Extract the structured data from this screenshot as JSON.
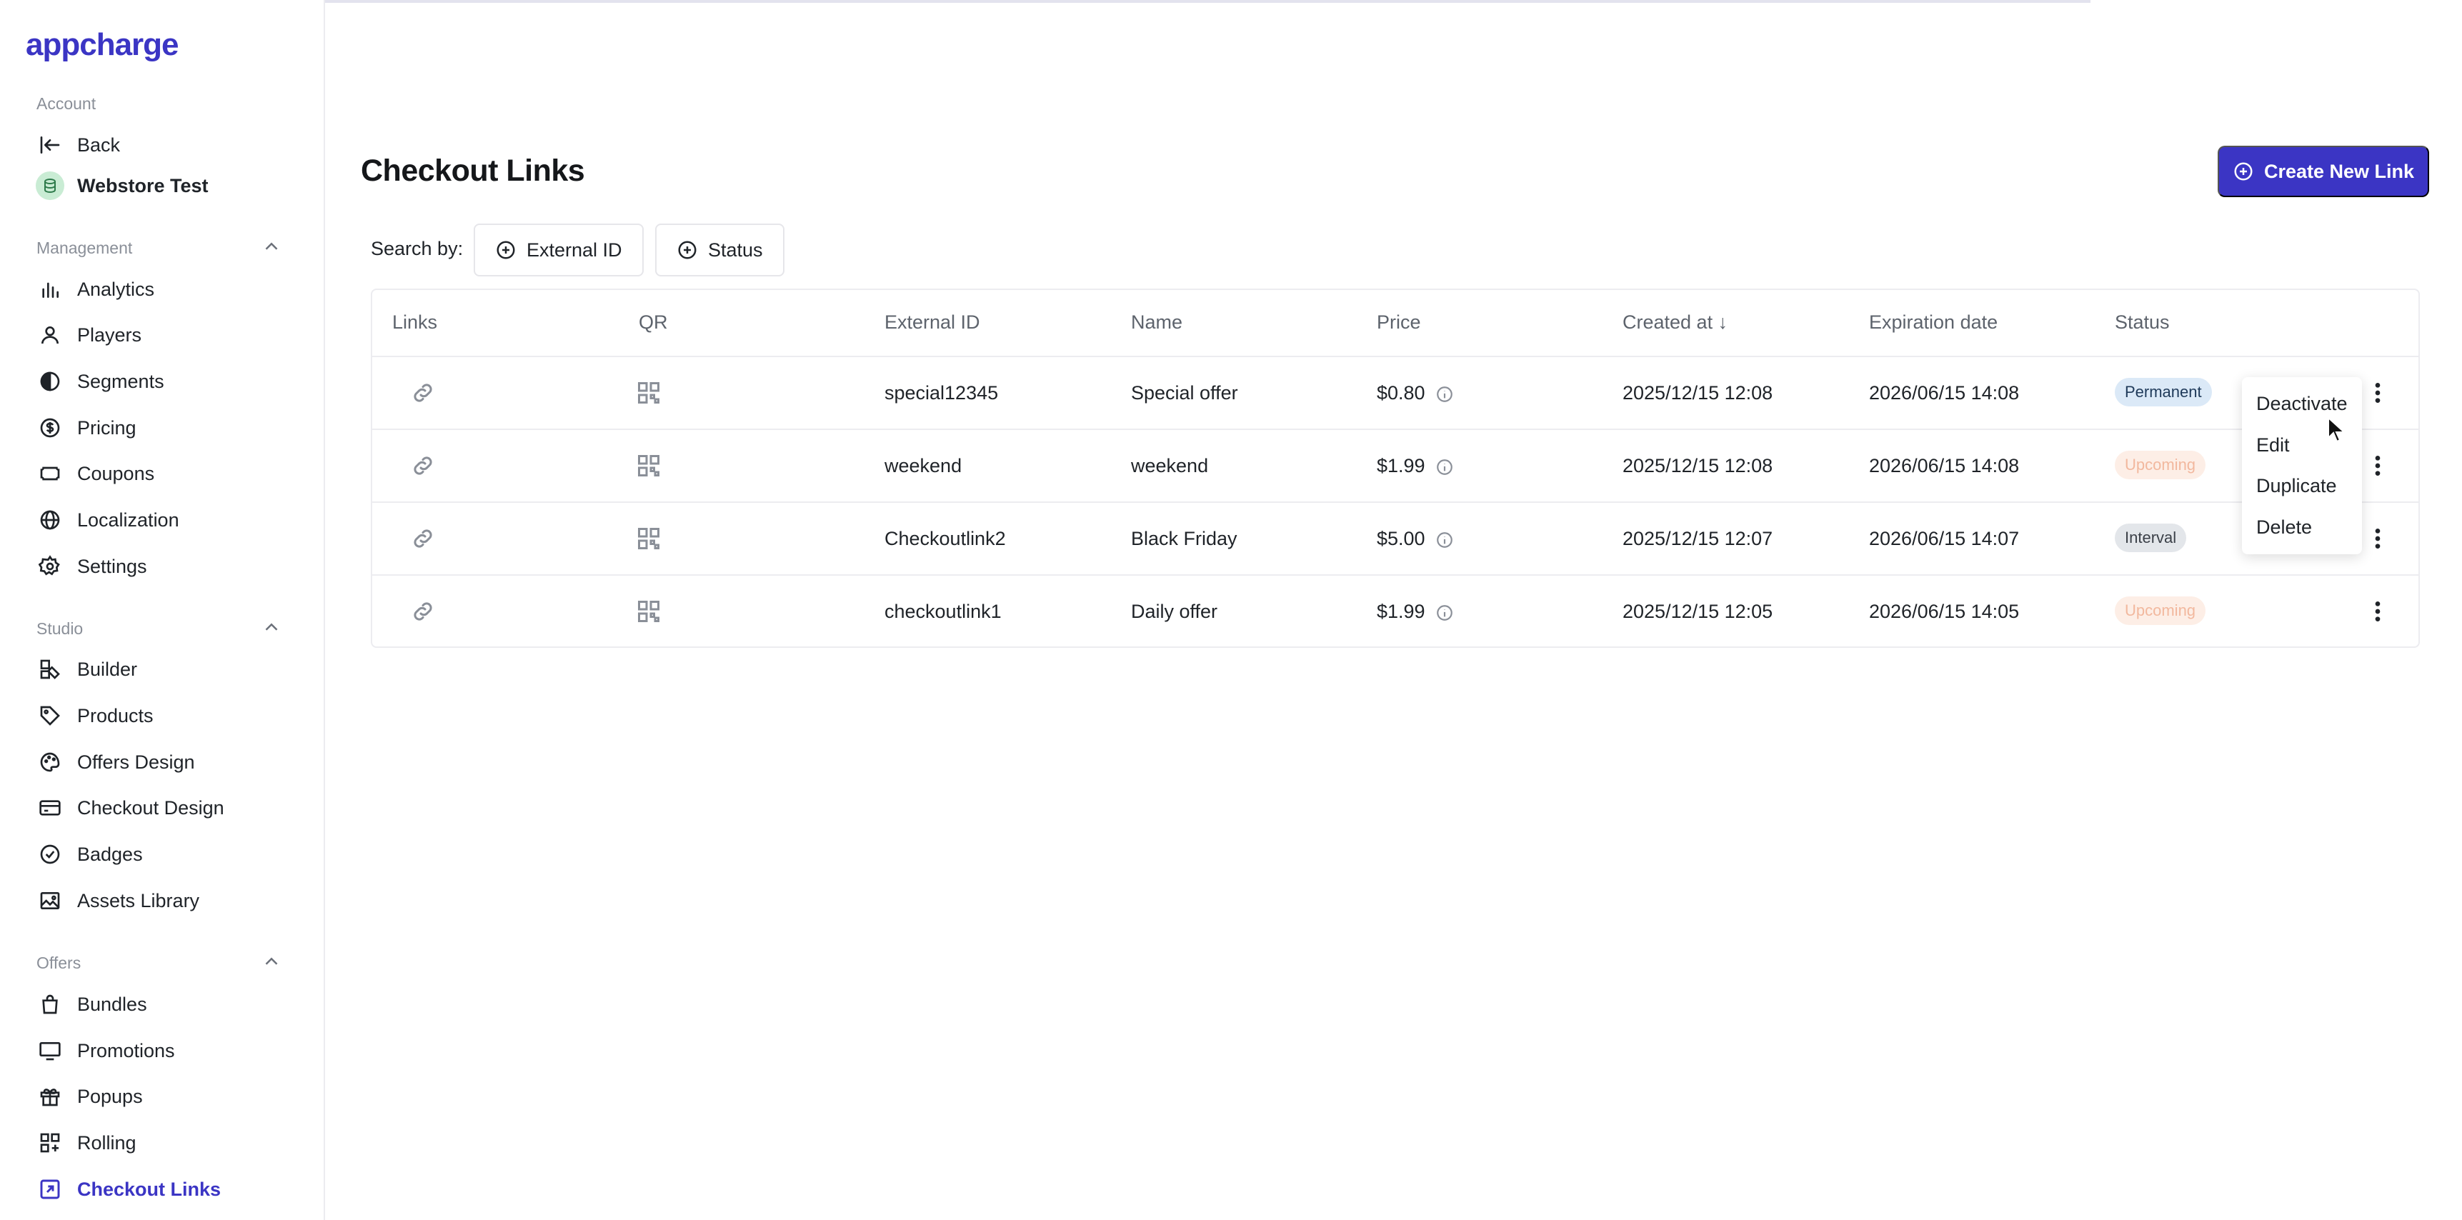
{
  "app": {
    "logo": "appcharge"
  },
  "sidebar": {
    "account_label": "Account",
    "back": "Back",
    "store": "Webstore Test",
    "management_label": "Management",
    "management": [
      {
        "label": "Analytics",
        "icon": "bar-chart-icon"
      },
      {
        "label": "Players",
        "icon": "user-icon"
      },
      {
        "label": "Segments",
        "icon": "pie-chart-icon"
      },
      {
        "label": "Pricing",
        "icon": "dollar-circle-icon"
      },
      {
        "label": "Coupons",
        "icon": "ticket-icon"
      },
      {
        "label": "Localization",
        "icon": "globe-icon"
      },
      {
        "label": "Settings",
        "icon": "gear-icon"
      }
    ],
    "studio_label": "Studio",
    "studio": [
      {
        "label": "Builder",
        "icon": "builder-icon"
      },
      {
        "label": "Products",
        "icon": "tag-icon"
      },
      {
        "label": "Offers Design",
        "icon": "palette-icon"
      },
      {
        "label": "Checkout Design",
        "icon": "card-icon"
      },
      {
        "label": "Badges",
        "icon": "badge-check-icon"
      },
      {
        "label": "Assets Library",
        "icon": "image-icon"
      }
    ],
    "offers_label": "Offers",
    "offers": [
      {
        "label": "Bundles",
        "icon": "bag-icon"
      },
      {
        "label": "Promotions",
        "icon": "monitor-icon"
      },
      {
        "label": "Popups",
        "icon": "gift-icon"
      },
      {
        "label": "Rolling",
        "icon": "grid-plus-icon"
      },
      {
        "label": "Checkout Links",
        "icon": "link-square-icon"
      }
    ]
  },
  "main": {
    "title": "Checkout Links",
    "create_button": "Create New Link",
    "search_label": "Search by:",
    "filters": [
      "External ID",
      "Status"
    ]
  },
  "table": {
    "columns": [
      "Links",
      "QR",
      "External ID",
      "Name",
      "Price",
      "Created at ↓",
      "Expiration date",
      "Status"
    ],
    "rows": [
      {
        "external_id": "special12345",
        "name": "Special offer",
        "price": "$0.80",
        "created": "2025/12/15 12:08",
        "expires": "2026/06/15 14:08",
        "status": "Permanent"
      },
      {
        "external_id": "weekend",
        "name": "weekend",
        "price": "$1.99",
        "created": "2025/12/15 12:08",
        "expires": "2026/06/15 14:08",
        "status": "Upcoming"
      },
      {
        "external_id": "Checkoutlink2",
        "name": "Black Friday",
        "price": "$5.00",
        "created": "2025/12/15 12:07",
        "expires": "2026/06/15 14:07",
        "status": "Interval"
      },
      {
        "external_id": "checkoutlink1",
        "name": "Daily offer",
        "price": "$1.99",
        "created": "2025/12/15 12:05",
        "expires": "2026/06/15 14:05",
        "status": "Upcoming"
      }
    ]
  },
  "row_menu": {
    "items": [
      "Deactivate",
      "Edit",
      "Duplicate",
      "Delete"
    ]
  },
  "colors": {
    "accent": "#3b35c4",
    "border": "#ececf0"
  }
}
